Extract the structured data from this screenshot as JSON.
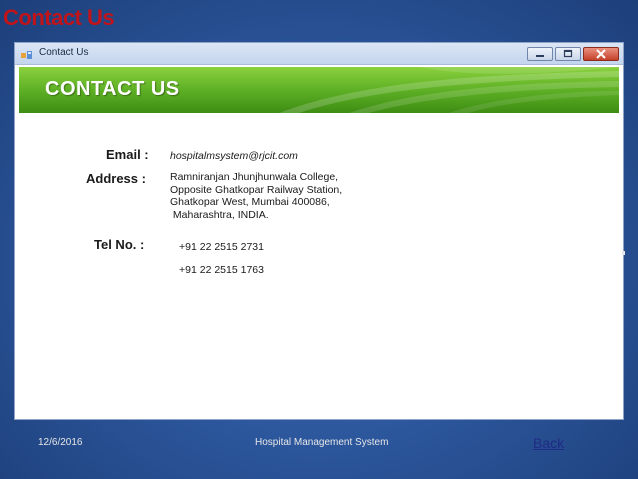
{
  "slide": {
    "title": "Contact Us"
  },
  "window": {
    "title": "Contact Us",
    "buttons": {
      "minimize_icon": "minimize-icon",
      "maximize_icon": "maximize-icon",
      "close_icon": "close-icon"
    }
  },
  "banner": {
    "title": "CONTACT US"
  },
  "contact": {
    "email_label": "Email :",
    "email_value": "hospitalmsystem@rjcit.com",
    "address_label": "Address :",
    "address_lines": [
      "Ramniranjan Jhunjhunwala College,",
      "Opposite Ghatkopar Railway Station,",
      "Ghatkopar West, Mumbai 400086,",
      " Maharashtra, INDIA."
    ],
    "tel_label": "Tel No. :",
    "tel_numbers": [
      "+91 22 2515 2731",
      "+91 22 2515 1763"
    ]
  },
  "footer": {
    "date": "12/6/2016",
    "center_text": "Hospital Management System",
    "back_link": "Back"
  },
  "colors": {
    "slide_title": "#c0141a",
    "banner_green": "#5eb025",
    "background_blue": "#2d589e",
    "link": "#1f2b86"
  }
}
